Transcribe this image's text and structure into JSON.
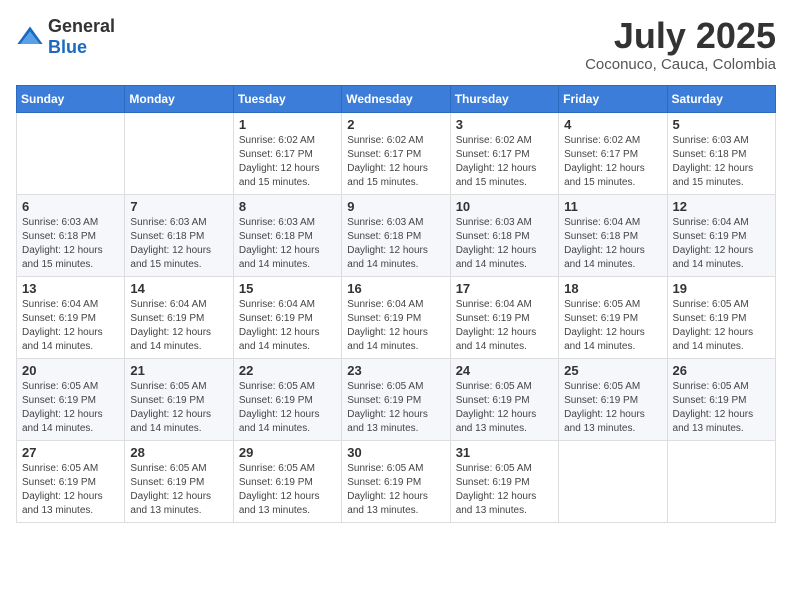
{
  "logo": {
    "general": "General",
    "blue": "Blue"
  },
  "header": {
    "month": "July 2025",
    "location": "Coconuco, Cauca, Colombia"
  },
  "weekdays": [
    "Sunday",
    "Monday",
    "Tuesday",
    "Wednesday",
    "Thursday",
    "Friday",
    "Saturday"
  ],
  "weeks": [
    [
      {
        "day": "",
        "info": ""
      },
      {
        "day": "",
        "info": ""
      },
      {
        "day": "1",
        "info": "Sunrise: 6:02 AM\nSunset: 6:17 PM\nDaylight: 12 hours and 15 minutes."
      },
      {
        "day": "2",
        "info": "Sunrise: 6:02 AM\nSunset: 6:17 PM\nDaylight: 12 hours and 15 minutes."
      },
      {
        "day": "3",
        "info": "Sunrise: 6:02 AM\nSunset: 6:17 PM\nDaylight: 12 hours and 15 minutes."
      },
      {
        "day": "4",
        "info": "Sunrise: 6:02 AM\nSunset: 6:17 PM\nDaylight: 12 hours and 15 minutes."
      },
      {
        "day": "5",
        "info": "Sunrise: 6:03 AM\nSunset: 6:18 PM\nDaylight: 12 hours and 15 minutes."
      }
    ],
    [
      {
        "day": "6",
        "info": "Sunrise: 6:03 AM\nSunset: 6:18 PM\nDaylight: 12 hours and 15 minutes."
      },
      {
        "day": "7",
        "info": "Sunrise: 6:03 AM\nSunset: 6:18 PM\nDaylight: 12 hours and 15 minutes."
      },
      {
        "day": "8",
        "info": "Sunrise: 6:03 AM\nSunset: 6:18 PM\nDaylight: 12 hours and 14 minutes."
      },
      {
        "day": "9",
        "info": "Sunrise: 6:03 AM\nSunset: 6:18 PM\nDaylight: 12 hours and 14 minutes."
      },
      {
        "day": "10",
        "info": "Sunrise: 6:03 AM\nSunset: 6:18 PM\nDaylight: 12 hours and 14 minutes."
      },
      {
        "day": "11",
        "info": "Sunrise: 6:04 AM\nSunset: 6:18 PM\nDaylight: 12 hours and 14 minutes."
      },
      {
        "day": "12",
        "info": "Sunrise: 6:04 AM\nSunset: 6:19 PM\nDaylight: 12 hours and 14 minutes."
      }
    ],
    [
      {
        "day": "13",
        "info": "Sunrise: 6:04 AM\nSunset: 6:19 PM\nDaylight: 12 hours and 14 minutes."
      },
      {
        "day": "14",
        "info": "Sunrise: 6:04 AM\nSunset: 6:19 PM\nDaylight: 12 hours and 14 minutes."
      },
      {
        "day": "15",
        "info": "Sunrise: 6:04 AM\nSunset: 6:19 PM\nDaylight: 12 hours and 14 minutes."
      },
      {
        "day": "16",
        "info": "Sunrise: 6:04 AM\nSunset: 6:19 PM\nDaylight: 12 hours and 14 minutes."
      },
      {
        "day": "17",
        "info": "Sunrise: 6:04 AM\nSunset: 6:19 PM\nDaylight: 12 hours and 14 minutes."
      },
      {
        "day": "18",
        "info": "Sunrise: 6:05 AM\nSunset: 6:19 PM\nDaylight: 12 hours and 14 minutes."
      },
      {
        "day": "19",
        "info": "Sunrise: 6:05 AM\nSunset: 6:19 PM\nDaylight: 12 hours and 14 minutes."
      }
    ],
    [
      {
        "day": "20",
        "info": "Sunrise: 6:05 AM\nSunset: 6:19 PM\nDaylight: 12 hours and 14 minutes."
      },
      {
        "day": "21",
        "info": "Sunrise: 6:05 AM\nSunset: 6:19 PM\nDaylight: 12 hours and 14 minutes."
      },
      {
        "day": "22",
        "info": "Sunrise: 6:05 AM\nSunset: 6:19 PM\nDaylight: 12 hours and 14 minutes."
      },
      {
        "day": "23",
        "info": "Sunrise: 6:05 AM\nSunset: 6:19 PM\nDaylight: 12 hours and 13 minutes."
      },
      {
        "day": "24",
        "info": "Sunrise: 6:05 AM\nSunset: 6:19 PM\nDaylight: 12 hours and 13 minutes."
      },
      {
        "day": "25",
        "info": "Sunrise: 6:05 AM\nSunset: 6:19 PM\nDaylight: 12 hours and 13 minutes."
      },
      {
        "day": "26",
        "info": "Sunrise: 6:05 AM\nSunset: 6:19 PM\nDaylight: 12 hours and 13 minutes."
      }
    ],
    [
      {
        "day": "27",
        "info": "Sunrise: 6:05 AM\nSunset: 6:19 PM\nDaylight: 12 hours and 13 minutes."
      },
      {
        "day": "28",
        "info": "Sunrise: 6:05 AM\nSunset: 6:19 PM\nDaylight: 12 hours and 13 minutes."
      },
      {
        "day": "29",
        "info": "Sunrise: 6:05 AM\nSunset: 6:19 PM\nDaylight: 12 hours and 13 minutes."
      },
      {
        "day": "30",
        "info": "Sunrise: 6:05 AM\nSunset: 6:19 PM\nDaylight: 12 hours and 13 minutes."
      },
      {
        "day": "31",
        "info": "Sunrise: 6:05 AM\nSunset: 6:19 PM\nDaylight: 12 hours and 13 minutes."
      },
      {
        "day": "",
        "info": ""
      },
      {
        "day": "",
        "info": ""
      }
    ]
  ]
}
